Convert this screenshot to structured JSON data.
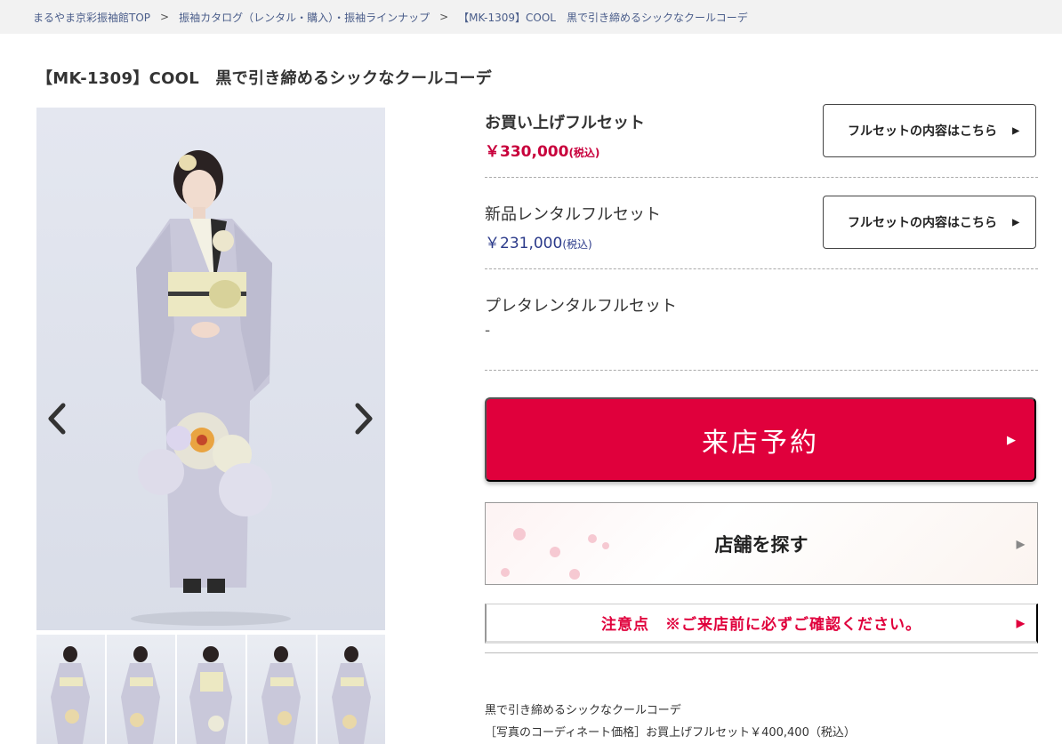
{
  "breadcrumb": {
    "items": [
      "まるやま京彩振袖館TOP",
      "振袖カタログ（レンタル・購入）・振袖ラインナップ",
      "【MK-1309】COOL　黒で引き締めるシックなクールコーデ"
    ],
    "separator": ">"
  },
  "page_title": "【MK-1309】COOL　黒で引き締めるシックなクールコーデ",
  "prices": [
    {
      "name": "お買い上げフルセット",
      "price": "￥330,000",
      "tax": "(税込)",
      "button": "フルセットの内容はこちら"
    },
    {
      "name": "新品レンタルフルセット",
      "price": "￥231,000",
      "tax": "(税込)",
      "button": "フルセットの内容はこちら"
    },
    {
      "name": "プレタレンタルフルセット",
      "price": "-"
    }
  ],
  "icons": {
    "prev": "chevron-left-icon",
    "next": "chevron-right-icon",
    "arrow": "triangle-right-icon"
  },
  "arrow_glyph": "▶",
  "reserve_button": "来店予約",
  "store_button": "店舗を探す",
  "notice_button": "注意点　※ご来店前に必ずご確認ください。",
  "description": {
    "line1": "黒で引き締めるシックなクールコーデ",
    "line2": "［写真のコーディネート価格］お買上げフルセット￥400,400（税込）"
  },
  "colors": {
    "accent_red": "#e0003c",
    "price_red": "#c8003c",
    "price_blue": "#2b3a8a",
    "kimono": "#c9c8da"
  }
}
